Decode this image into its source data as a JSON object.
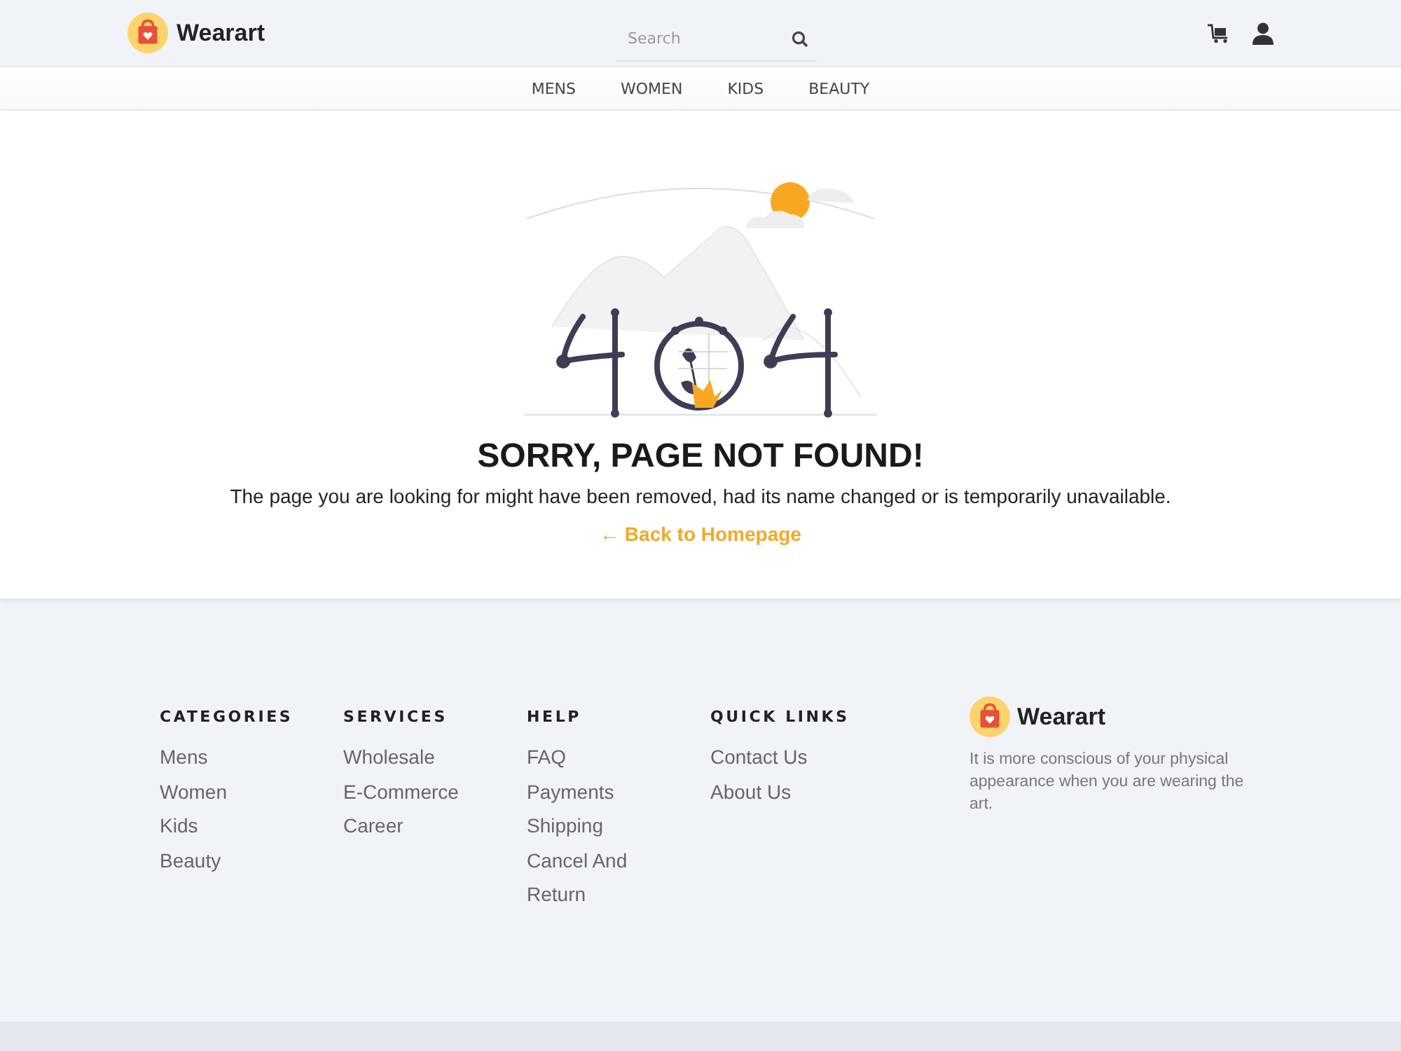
{
  "header": {
    "brand": "Wearart",
    "search": {
      "placeholder": "Search"
    }
  },
  "nav": [
    {
      "label": "MENS"
    },
    {
      "label": "WOMEN"
    },
    {
      "label": "KIDS"
    },
    {
      "label": "BEAUTY"
    }
  ],
  "error": {
    "title": "SORRY, PAGE NOT FOUND!",
    "message": "The page you are looking for might have been removed, had its name changed or is temporarily unavailable.",
    "link": "← Back to Homepage"
  },
  "footer": {
    "columns": [
      {
        "heading": "CATEGORIES",
        "links": [
          "Mens",
          "Women",
          "Kids",
          "Beauty"
        ]
      },
      {
        "heading": "SERVICES",
        "links": [
          "Wholesale",
          "E-Commerce",
          "Career"
        ]
      },
      {
        "heading": "HELP",
        "links": [
          "FAQ",
          "Payments",
          "Shipping",
          "Cancel And",
          "Return"
        ]
      },
      {
        "heading": "QUICK LINKS",
        "links": [
          "Contact Us",
          "About Us"
        ]
      }
    ],
    "brand": "Wearart",
    "tagline": "It is more conscious of your physical appearance when you are wearing the art."
  }
}
